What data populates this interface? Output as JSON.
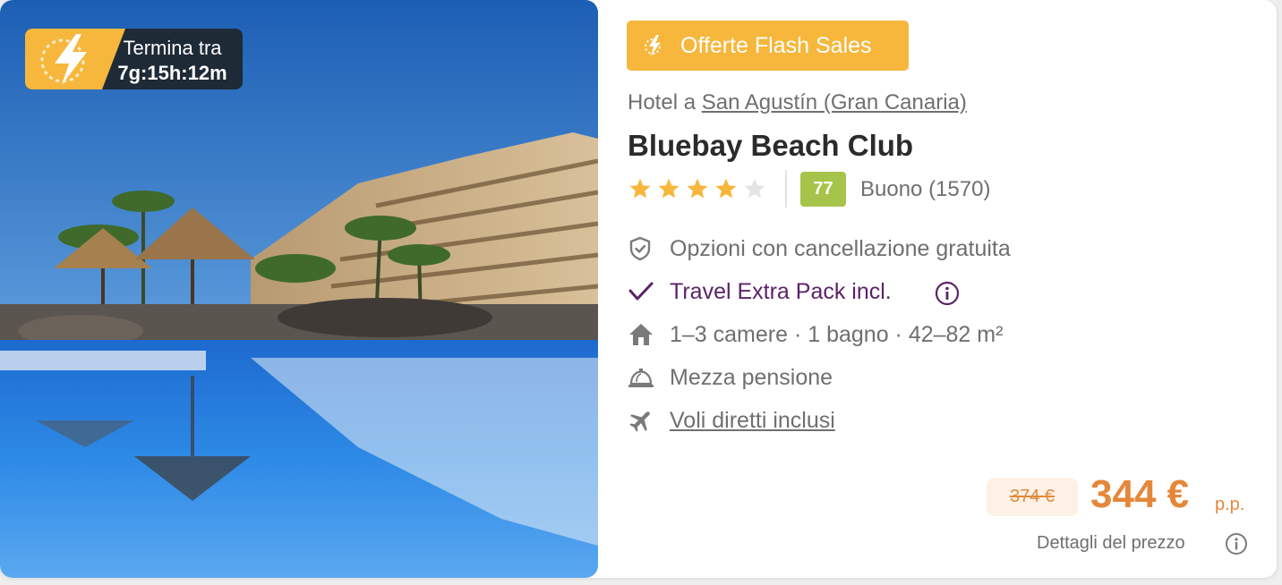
{
  "timer": {
    "label": "Termina tra",
    "value": "7g:15h:12m",
    "icon": "lightning-bolt-icon"
  },
  "badge": {
    "label": "Offerte Flash Sales",
    "icon": "lightning-bolt-icon",
    "color": "#f6b73c"
  },
  "location": {
    "prefix": "Hotel a",
    "place": "San Agustín (Gran Canaria)"
  },
  "hotel": {
    "name": "Bluebay Beach Club",
    "stars": 4,
    "stars_max": 5,
    "score": "77",
    "score_color": "#a7c44a",
    "score_text": "Buono (1570)"
  },
  "features": [
    {
      "icon": "shield-check-icon",
      "text": "Opzioni con cancellazione gratuita"
    },
    {
      "icon": "checkmark-icon",
      "text": "Travel Extra Pack incl."
    },
    {
      "icon": "house-icon",
      "text": "1–3 camere · 1 bagno · 42–82 m²"
    },
    {
      "icon": "cloche-icon",
      "text": "Mezza pensione"
    },
    {
      "icon": "airplane-icon",
      "text": "Voli diretti inclusi"
    }
  ],
  "price": {
    "old": "374 €",
    "current": "344 €",
    "suffix": "p.p.",
    "details_label": "Dettagli del prezzo",
    "accent_color": "#e5873a"
  }
}
